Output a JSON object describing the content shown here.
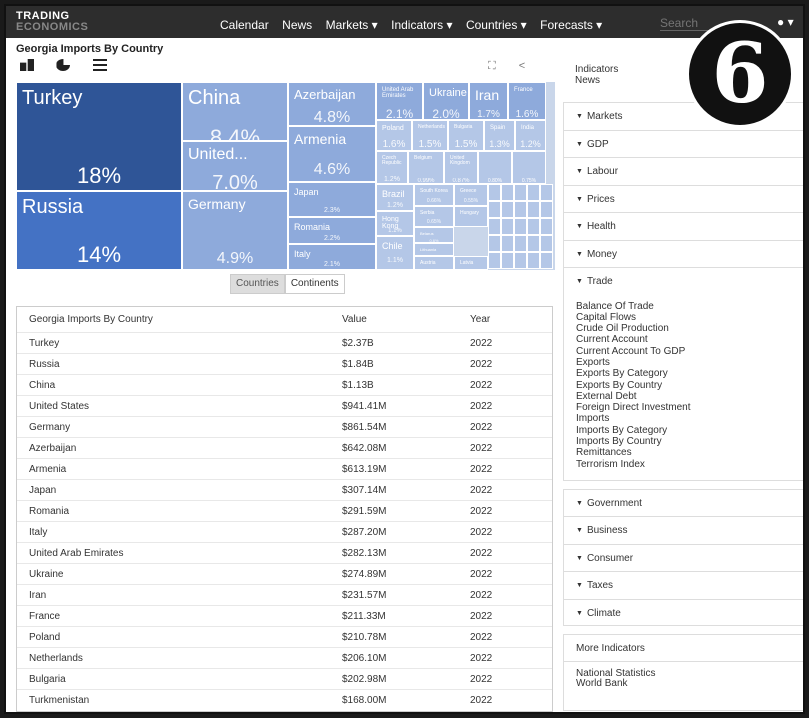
{
  "brand": {
    "line1": "TRADING",
    "line2": "ECONOMICS"
  },
  "nav": [
    "Calendar",
    "News",
    "Markets",
    "Indicators",
    "Countries",
    "Forecasts"
  ],
  "search": {
    "placeholder": "Search"
  },
  "page_title": "Georgia Imports By Country",
  "treemap": [
    {
      "name": "Turkey",
      "pct": "18%"
    },
    {
      "name": "China",
      "pct": "8.4%"
    },
    {
      "name": "Azerbaijan",
      "pct": "4.8%"
    },
    {
      "name": "United Arab Emirates",
      "pct": "2.1%"
    },
    {
      "name": "Ukraine",
      "pct": "2.0%"
    },
    {
      "name": "Iran",
      "pct": "1.7%"
    },
    {
      "name": "France",
      "pct": "1.6%"
    },
    {
      "name": "Armenia",
      "pct": "4.6%"
    },
    {
      "name": "Poland",
      "pct": "1.6%"
    },
    {
      "name": "Netherlands",
      "pct": "1.5%"
    },
    {
      "name": "Bulgaria",
      "pct": "1.5%"
    },
    {
      "name": "Spain",
      "pct": "1.3%"
    },
    {
      "name": "India",
      "pct": "1.2%"
    },
    {
      "name": "Czech Republic",
      "pct": "1.2%"
    },
    {
      "name": "Belgium",
      "pct": "0.99%"
    },
    {
      "name": "United Kingdom",
      "pct": "0.87%"
    },
    {
      "name": "United...",
      "pct": "7.0%"
    },
    {
      "name": "Russia",
      "pct": "14%"
    },
    {
      "name": "Japan",
      "pct": "2.3%"
    },
    {
      "name": "Brazil",
      "pct": "1.2%"
    },
    {
      "name": "South Korea",
      "pct": "0.66%"
    },
    {
      "name": "Greece",
      "pct": "0.55%"
    },
    {
      "name": "Romania",
      "pct": "2.2%"
    },
    {
      "name": "Hong Kong",
      "pct": "1.1%"
    },
    {
      "name": "Serbia",
      "pct": "0.65%"
    },
    {
      "name": "Hungary",
      "pct": ""
    },
    {
      "name": "Belarus",
      "pct": "0.6%"
    },
    {
      "name": "Germany",
      "pct": "4.9%"
    },
    {
      "name": "Italy",
      "pct": "2.1%"
    },
    {
      "name": "Chile",
      "pct": "1.1%"
    },
    {
      "name": "Lithuania",
      "pct": ""
    },
    {
      "name": "Austria",
      "pct": ""
    },
    {
      "name": "Latvia",
      "pct": ""
    }
  ],
  "treemap_extra": [
    "0.80%",
    "0.75%"
  ],
  "segments": {
    "countries": "Countries",
    "continents": "Continents"
  },
  "table": {
    "headers": [
      "Georgia Imports By Country",
      "Value",
      "Year"
    ],
    "rows": [
      [
        "Turkey",
        "$2.37B",
        "2022"
      ],
      [
        "Russia",
        "$1.84B",
        "2022"
      ],
      [
        "China",
        "$1.13B",
        "2022"
      ],
      [
        "United States",
        "$941.41M",
        "2022"
      ],
      [
        "Germany",
        "$861.54M",
        "2022"
      ],
      [
        "Azerbaijan",
        "$642.08M",
        "2022"
      ],
      [
        "Armenia",
        "$613.19M",
        "2022"
      ],
      [
        "Japan",
        "$307.14M",
        "2022"
      ],
      [
        "Romania",
        "$291.59M",
        "2022"
      ],
      [
        "Italy",
        "$287.20M",
        "2022"
      ],
      [
        "United Arab Emirates",
        "$282.13M",
        "2022"
      ],
      [
        "Ukraine",
        "$274.89M",
        "2022"
      ],
      [
        "Iran",
        "$231.57M",
        "2022"
      ],
      [
        "France",
        "$211.33M",
        "2022"
      ],
      [
        "Poland",
        "$210.78M",
        "2022"
      ],
      [
        "Netherlands",
        "$206.10M",
        "2022"
      ],
      [
        "Bulgaria",
        "$202.98M",
        "2022"
      ],
      [
        "Turkmenistan",
        "$168.00M",
        "2022"
      ]
    ]
  },
  "sidebar": {
    "top": [
      "Indicators",
      "News"
    ],
    "groups_a": [
      "Markets",
      "GDP",
      "Labour",
      "Prices",
      "Health",
      "Money",
      "Trade"
    ],
    "trade_list": [
      "Balance Of Trade",
      "Capital Flows",
      "Crude Oil Production",
      "Current Account",
      "Current Account To GDP",
      "Exports",
      "Exports By Category",
      "Exports By Country",
      "External Debt",
      "Foreign Direct Investment",
      "Imports",
      "Imports By Category",
      "Imports By Country",
      "Remittances",
      "Terrorism Index"
    ],
    "groups_b": [
      "Government",
      "Business",
      "Consumer",
      "Taxes",
      "Climate"
    ],
    "more": {
      "header": "More Indicators",
      "links": [
        "National Statistics",
        "World Bank"
      ]
    }
  },
  "badge": "6",
  "colors": {
    "dark_tile": "#2f5597",
    "mid_tile": "#4472c4",
    "light_tile": "#8eaadb",
    "pale_tile": "#b4c7e7"
  }
}
